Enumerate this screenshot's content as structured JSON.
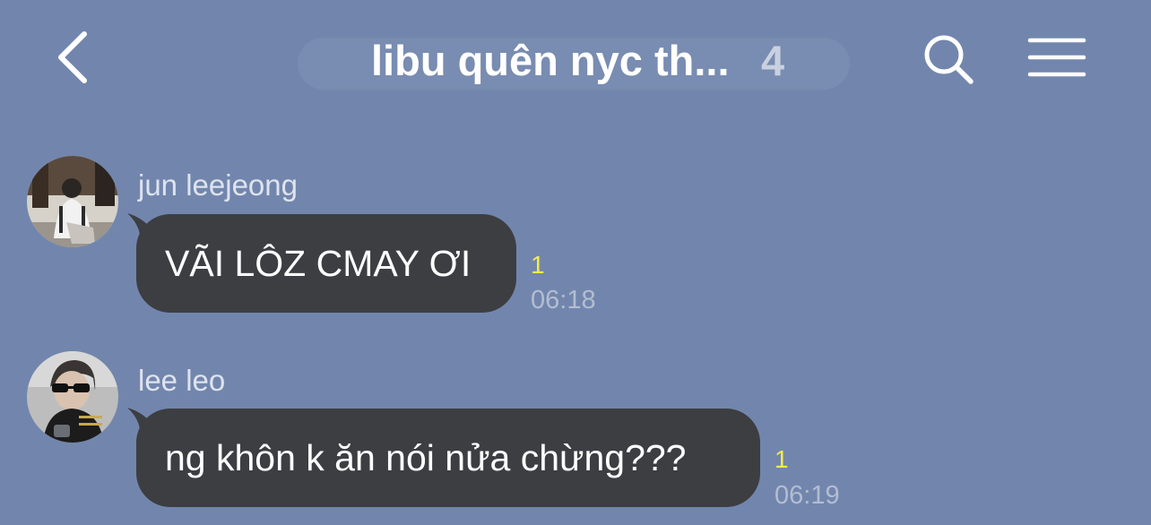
{
  "header": {
    "title": "libu quên nyc th...",
    "member_count": "4",
    "back_icon": "chevron-left-icon",
    "search_icon": "search-icon",
    "menu_icon": "hamburger-menu-icon"
  },
  "colors": {
    "background": "#7286ad",
    "bubble": "#3d3e42",
    "unread": "#f3ec4a",
    "time": "#b3bdd2",
    "sender": "#dde3ef"
  },
  "messages": [
    {
      "sender": "jun leejeong",
      "text": "VÃI LÔZ CMAY ƠI",
      "unread": "1",
      "time": "06:18"
    },
    {
      "sender": "lee leo",
      "text": "ng khôn k ăn nói nửa chừng???",
      "unread": "1",
      "time": "06:19"
    }
  ]
}
